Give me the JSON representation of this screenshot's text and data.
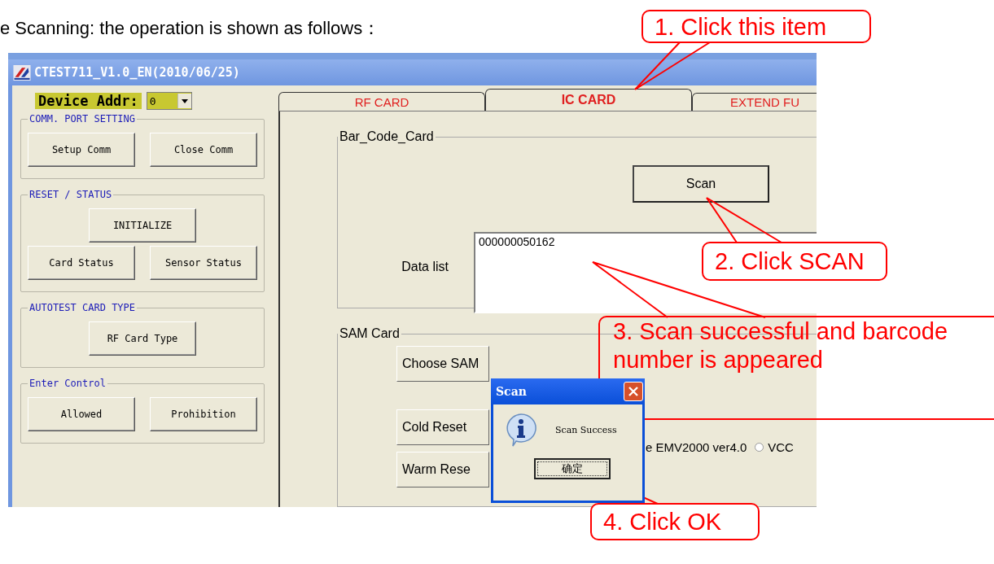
{
  "caption": "e Scanning: the operation is shown as follows：",
  "app": {
    "title": "CTEST711_V1.0_EN(2010/06/25)",
    "device_addr": {
      "label": "Device Addr:",
      "value": "0"
    },
    "groups": [
      {
        "title": "COMM. PORT SETTING",
        "rows": [
          {
            "buttons": [
              "Setup Comm",
              "Close Comm"
            ]
          }
        ]
      },
      {
        "title": "RESET / STATUS",
        "rows": [
          {
            "buttons": [
              "INITIALIZE"
            ]
          },
          {
            "buttons": [
              "Card Status",
              "Sensor Status"
            ]
          }
        ]
      },
      {
        "title": "AUTOTEST CARD TYPE",
        "rows": [
          {
            "buttons": [
              "RF Card Type"
            ]
          }
        ]
      },
      {
        "title": "Enter Control",
        "rows": [
          {
            "buttons": [
              "Allowed",
              "Prohibition"
            ]
          }
        ]
      }
    ],
    "tabs": [
      {
        "label": "RF CARD",
        "selected": false
      },
      {
        "label": "IC CARD",
        "selected": true
      },
      {
        "label": "EXTEND FU",
        "selected": false
      }
    ],
    "bar_code_card": {
      "title": "Bar_Code_Card",
      "scan_button": "Scan",
      "data_list_label": "Data list",
      "data_list_value": "000000050162"
    },
    "sam_card": {
      "title": "SAM Card",
      "buttons": [
        "Choose SAM",
        "Cold Reset",
        "Warm Rese"
      ],
      "option_text": "e EMV2000 ver4.0",
      "radio": {
        "label": "VCC",
        "checked": false
      }
    },
    "dialog": {
      "title": "Scan",
      "message": "Scan Success",
      "button": "确定"
    }
  },
  "callouts": [
    {
      "text": "1. Click this item"
    },
    {
      "text": "2. Click SCAN"
    },
    {
      "text": "3. Scan successful and barcode number is appeared"
    },
    {
      "text": "4. Click OK"
    }
  ]
}
